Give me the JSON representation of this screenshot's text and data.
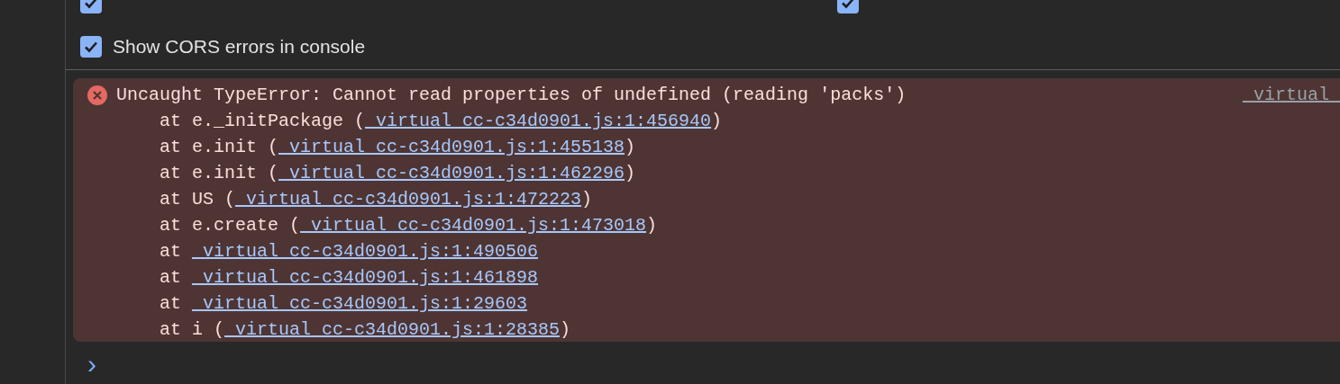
{
  "settings": [
    {
      "checked": true
    },
    {
      "checked": true
    },
    {
      "label": "Show CORS errors in console",
      "checked": true
    }
  ],
  "error": {
    "message": "Uncaught TypeError: Cannot read properties of undefined (reading 'packs')",
    "source": "_virtual_",
    "stack": [
      {
        "before": "    at e._initPackage (",
        "link": "_virtual_cc-c34d0901.js:1:456940",
        "after": ")"
      },
      {
        "before": "    at e.init (",
        "link": "_virtual_cc-c34d0901.js:1:455138",
        "after": ")"
      },
      {
        "before": "    at e.init (",
        "link": "_virtual_cc-c34d0901.js:1:462296",
        "after": ")"
      },
      {
        "before": "    at US (",
        "link": "_virtual_cc-c34d0901.js:1:472223",
        "after": ")"
      },
      {
        "before": "    at e.create (",
        "link": "_virtual_cc-c34d0901.js:1:473018",
        "after": ")"
      },
      {
        "before": "    at ",
        "link": "_virtual_cc-c34d0901.js:1:490506"
      },
      {
        "before": "    at ",
        "link": "_virtual_cc-c34d0901.js:1:461898"
      },
      {
        "before": "    at ",
        "link": "_virtual_cc-c34d0901.js:1:29603"
      },
      {
        "before": "    at i (",
        "link": "_virtual_cc-c34d0901.js:1:28385",
        "after": ")"
      }
    ]
  },
  "prompt": "›"
}
